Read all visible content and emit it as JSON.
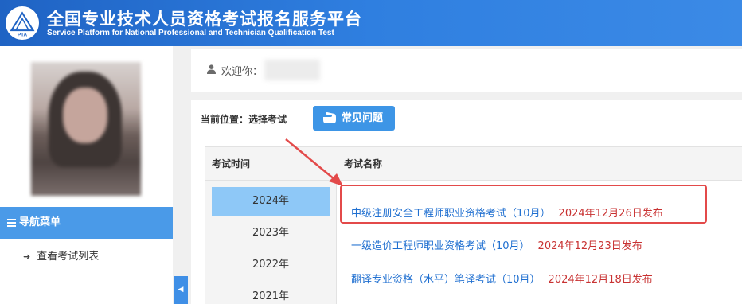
{
  "header": {
    "title_cn": "全国专业技术人员资格考试报名服务平台",
    "title_en": "Service Platform for National Professional and Technician Qualification Test",
    "logo_text": "PTA"
  },
  "sidebar": {
    "nav_menu_label": "导航菜单",
    "items": [
      {
        "label": "查看考试列表",
        "icon": "sign-in-icon"
      }
    ],
    "collapse_icon": "◀"
  },
  "welcome": {
    "label": "欢迎你："
  },
  "panel": {
    "location_label": "当前位置：选择考试",
    "faq_button": "常见问题"
  },
  "table": {
    "headers": {
      "time": "考试时间",
      "name": "考试名称"
    },
    "years": [
      "2024年",
      "2023年",
      "2022年",
      "2021年"
    ],
    "active_year": "2024年",
    "exams": [
      {
        "name": "中级注册安全工程师职业资格考试（10月）",
        "date": "2024年12月26日发布",
        "highlighted": true
      },
      {
        "name": "一级造价工程师职业资格考试（10月）",
        "date": "2024年12月23日发布",
        "highlighted": false
      },
      {
        "name": "翻译专业资格（水平）笔译考试（10月）",
        "date": "2024年12月18日发布",
        "highlighted": false
      }
    ]
  },
  "colors": {
    "header_blue": "#2f7fe0",
    "nav_blue": "#4a9ae8",
    "active_year": "#8ec8f7",
    "link_blue": "#1f6fd0",
    "date_red": "#c83232",
    "annotation_red": "#e34a4a"
  }
}
